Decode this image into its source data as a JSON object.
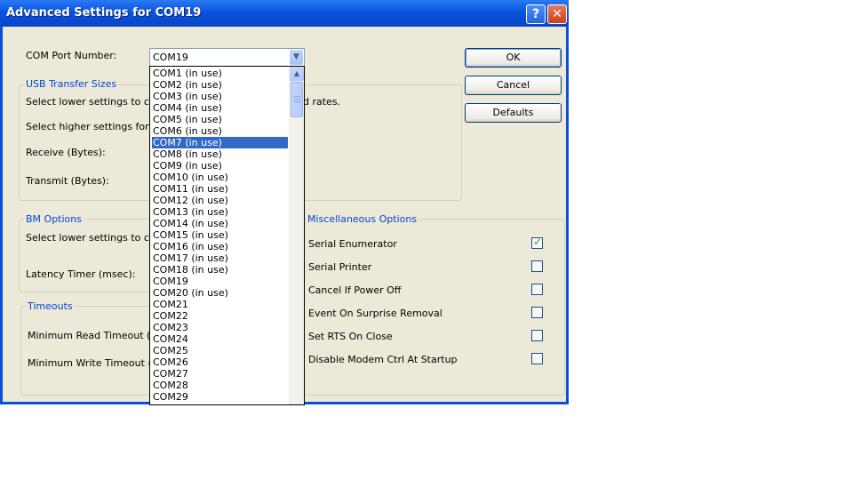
{
  "window": {
    "title": "Advanced Settings for COM19",
    "help_glyph": "?",
    "close_glyph": "✕"
  },
  "com_port": {
    "label": "COM Port Number:",
    "value": "COM19",
    "arrow_icon": "chevron-down-icon"
  },
  "dropdown": {
    "selected": "COM7 (in use)",
    "items": [
      "COM1 (in use)",
      "COM2 (in use)",
      "COM3 (in use)",
      "COM4 (in use)",
      "COM5 (in use)",
      "COM6 (in use)",
      "COM7 (in use)",
      "COM8 (in use)",
      "COM9 (in use)",
      "COM10 (in use)",
      "COM11 (in use)",
      "COM12 (in use)",
      "COM13 (in use)",
      "COM14 (in use)",
      "COM15 (in use)",
      "COM16 (in use)",
      "COM17 (in use)",
      "COM18 (in use)",
      "COM19",
      "COM20 (in use)",
      "COM21",
      "COM22",
      "COM23",
      "COM24",
      "COM25",
      "COM26",
      "COM27",
      "COM28",
      "COM29"
    ]
  },
  "buttons": {
    "ok": "OK",
    "cancel": "Cancel",
    "defaults": "Defaults"
  },
  "usb": {
    "title": "USB Transfer Sizes",
    "line1": "Select lower settings to corre",
    "line1_tail": "d rates.",
    "line2": "Select higher settings for fas",
    "receive": "Receive (Bytes):",
    "transmit": "Transmit (Bytes):"
  },
  "bm": {
    "title": "BM Options",
    "line1": "Select lower settings to corre",
    "latency": "Latency Timer (msec):"
  },
  "timeouts": {
    "title": "Timeouts",
    "read": "Minimum Read Timeout (msec",
    "write": "Minimum Write Timeout (mse"
  },
  "misc": {
    "title": "Miscellaneous Options",
    "options": [
      {
        "label": "Serial Enumerator",
        "checked": true
      },
      {
        "label": "Serial Printer",
        "checked": false
      },
      {
        "label": "Cancel If Power Off",
        "checked": false
      },
      {
        "label": "Event On Surprise Removal",
        "checked": false
      },
      {
        "label": "Set RTS On Close",
        "checked": false
      },
      {
        "label": "Disable Modem Ctrl At Startup",
        "checked": false
      }
    ]
  },
  "colors": {
    "titlebar": "#0a52dc",
    "face": "#ece9d8",
    "group_title": "#0046d5",
    "selection": "#316ac5"
  }
}
